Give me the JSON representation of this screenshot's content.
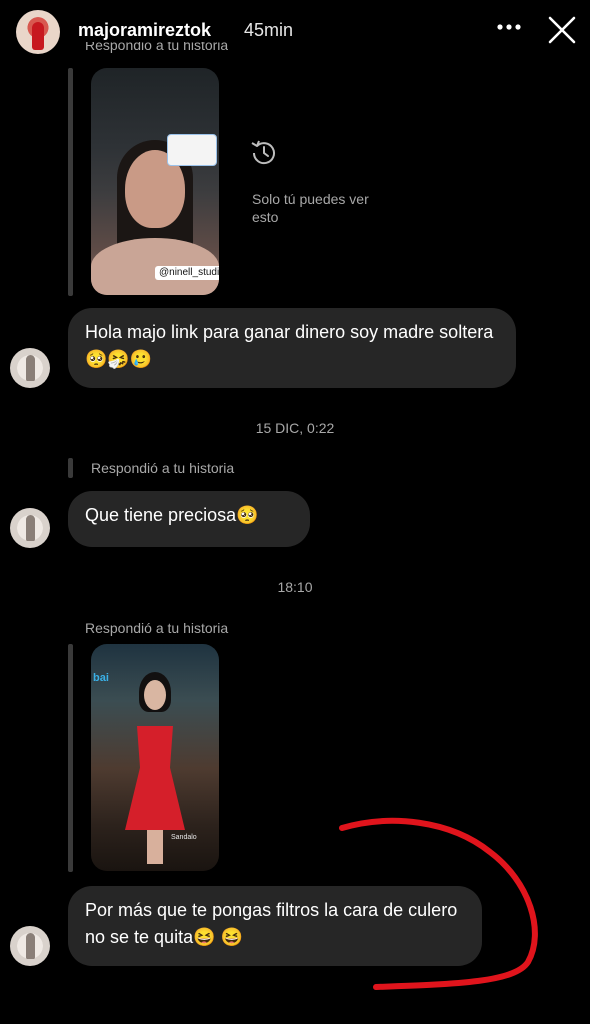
{
  "header": {
    "username": "majoramireztok",
    "time_ago": "45min"
  },
  "conversation": {
    "story1": {
      "reply_label": "Respondió a tu historia",
      "sticker_tag": "@ninell_studio",
      "only_you_text": "Solo tú puedes ver esto"
    },
    "message1": {
      "text": "Hola majo link para ganar dinero soy madre soltera",
      "emojis": "🥺🤧🥲"
    },
    "timestamp1": "15 DIC, 0:22",
    "reply2_label": "Respondió a tu historia",
    "message2": {
      "text": "Que tiene preciosa",
      "emojis": "🥺"
    },
    "timestamp2": "18:10",
    "story2": {
      "reply_label": "Respondió a tu historia",
      "sign_text": "bai",
      "caption": "Sandalo"
    },
    "message3": {
      "text": "Por más que te pongas filtros la cara de culero no se te quita",
      "emojis": "😆 😆"
    }
  },
  "colors": {
    "background": "#000000",
    "bubble": "#262626",
    "secondary_text": "#a8a8a8",
    "annotation": "#e0141c"
  }
}
